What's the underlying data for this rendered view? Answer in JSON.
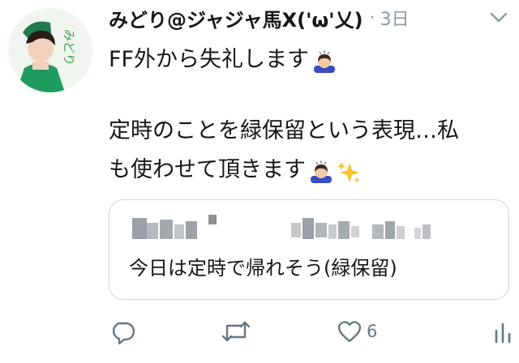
{
  "tweet": {
    "author_name": "みどり@ジャジャ馬X('ω'乂)",
    "separator": "·",
    "time": "3日",
    "avatar_text": "みどり",
    "lines": [
      "FF外から失礼します",
      "定時のことを緑保留という表現…私",
      "も使わせて頂きます"
    ],
    "quoted": {
      "text": "今日は定時で帰れそう(緑保留)"
    },
    "actions": {
      "like_count": "6"
    }
  },
  "colors": {
    "text": "#14171a",
    "secondary": "#8899a6",
    "icon": "#657786",
    "border": "#ccd6dd"
  }
}
